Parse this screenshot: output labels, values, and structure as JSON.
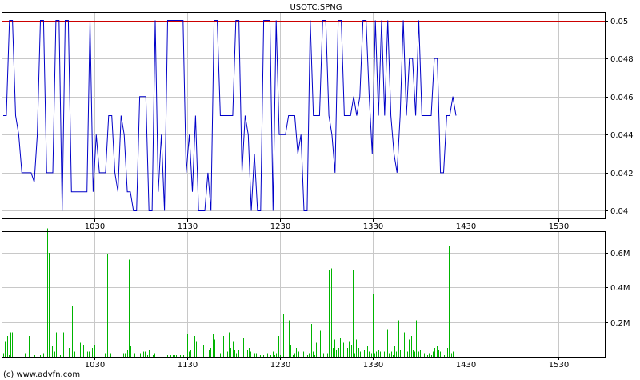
{
  "footer": {
    "credit": "(c) www.advfn.com"
  },
  "chart_data": [
    {
      "type": "line",
      "title": "USOTC:SPNG",
      "x_ticks": [
        "1030",
        "1130",
        "1230",
        "1330",
        "1430",
        "1530"
      ],
      "y_ticks": [
        "0.04",
        "0.042",
        "0.044",
        "0.046",
        "0.048",
        "0.05"
      ],
      "ylim": [
        0.0396,
        0.0504
      ],
      "grid": true,
      "series": [
        {
          "color": "#0000c8",
          "values": [
            0.045,
            0.045,
            0.05,
            0.05,
            0.045,
            0.044,
            0.042,
            0.042,
            0.042,
            0.042,
            0.0415,
            0.044,
            0.05,
            0.05,
            0.042,
            0.042,
            0.042,
            0.05,
            0.05,
            0.04,
            0.05,
            0.05,
            0.041,
            0.041,
            0.041,
            0.041,
            0.041,
            0.041,
            0.05,
            0.041,
            0.044,
            0.042,
            0.042,
            0.042,
            0.045,
            0.045,
            0.042,
            0.041,
            0.045,
            0.044,
            0.041,
            0.041,
            0.04,
            0.04,
            0.046,
            0.046,
            0.046,
            0.04,
            0.04,
            0.05,
            0.041,
            0.044,
            0.04,
            0.05,
            0.05,
            0.05,
            0.05,
            0.05,
            0.05,
            0.042,
            0.044,
            0.041,
            0.045,
            0.04,
            0.04,
            0.04,
            0.042,
            0.04,
            0.05,
            0.05,
            0.045,
            0.045,
            0.045,
            0.045,
            0.045,
            0.05,
            0.05,
            0.042,
            0.045,
            0.044,
            0.04,
            0.043,
            0.04,
            0.04,
            0.05,
            0.05,
            0.05,
            0.04,
            0.05,
            0.044,
            0.044,
            0.044,
            0.045,
            0.045,
            0.045,
            0.043,
            0.044,
            0.04,
            0.04,
            0.05,
            0.045,
            0.045,
            0.045,
            0.05,
            0.05,
            0.045,
            0.044,
            0.042,
            0.05,
            0.05,
            0.045,
            0.045,
            0.045,
            0.046,
            0.045,
            0.046,
            0.05,
            0.05,
            0.046,
            0.043,
            0.05,
            0.045,
            0.05,
            0.045,
            0.05,
            0.045,
            0.043,
            0.042,
            0.045,
            0.05,
            0.045,
            0.048,
            0.048,
            0.045,
            0.05,
            0.045,
            0.045,
            0.045,
            0.045,
            0.048,
            0.048,
            0.042,
            0.042,
            0.045,
            0.045,
            0.046,
            0.045
          ]
        }
      ],
      "reference_line": {
        "value": 0.05,
        "color": "#cc0000"
      }
    },
    {
      "type": "bar",
      "x_ticks": [
        "1030",
        "1130",
        "1230",
        "1330",
        "1430",
        "1530"
      ],
      "y_ticks": [
        "0.2M",
        "0.4M",
        "0.6M"
      ],
      "ylim": [
        0,
        0.72
      ],
      "grid": true,
      "bar_color": "#00b400",
      "values": [
        0.02,
        0.09,
        0.12,
        0.01,
        0.14,
        0.14,
        0,
        0,
        0,
        0,
        0.12,
        0,
        0.02,
        0,
        0.12,
        0,
        0,
        0.01,
        0,
        0,
        0.01,
        0,
        0.02,
        0,
        0.74,
        0.6,
        0,
        0.06,
        0.03,
        0.14,
        0,
        0.01,
        0,
        0.14,
        0,
        0,
        0.05,
        0,
        0.29,
        0.03,
        0,
        0.02,
        0.08,
        0.04,
        0.07,
        0,
        0.03,
        0.03,
        0,
        0.05,
        0.07,
        0,
        0.11,
        0,
        0.05,
        0,
        0.02,
        0.59,
        0,
        0.02,
        0,
        0,
        0,
        0.05,
        0,
        0,
        0.02,
        0.02,
        0.04,
        0.56,
        0.06,
        0,
        0.02,
        0,
        0.01,
        0.02,
        0,
        0.03,
        0.03,
        0.01,
        0.04,
        0,
        0.01,
        0.02,
        0,
        0.01,
        0,
        0,
        0,
        0,
        0.01,
        0,
        0.01,
        0.01,
        0.01,
        0.01,
        0,
        0.01,
        0.02,
        0.01,
        0.04,
        0.13,
        0.03,
        0.04,
        0,
        0.12,
        0.09,
        0.01,
        0,
        0.02,
        0.07,
        0.03,
        0,
        0.04,
        0.05,
        0.13,
        0.1,
        0,
        0.29,
        0.02,
        0.08,
        0.12,
        0.01,
        0.03,
        0.14,
        0.05,
        0.09,
        0.04,
        0.02,
        0.04,
        0,
        0.02,
        0.11,
        0,
        0.04,
        0.05,
        0.03,
        0,
        0.02,
        0.02,
        0,
        0.01,
        0.02,
        0.01,
        0,
        0.02,
        0,
        0.01,
        0.03,
        0.01,
        0.02,
        0.12,
        0.01,
        0.03,
        0.25,
        0.01,
        0,
        0.21,
        0.07,
        0.01,
        0.02,
        0.05,
        0.03,
        0,
        0.21,
        0.03,
        0.08,
        0.01,
        0.02,
        0.19,
        0.03,
        0.01,
        0.08,
        0,
        0.15,
        0.03,
        0.02,
        0.04,
        0.02,
        0.5,
        0.51,
        0.05,
        0.1,
        0.04,
        0.05,
        0.11,
        0.07,
        0.08,
        0.08,
        0.05,
        0.09,
        0.07,
        0.5,
        0.02,
        0.1,
        0.05,
        0.03,
        0.02,
        0.04,
        0.04,
        0.06,
        0.03,
        0.02,
        0.36,
        0.02,
        0.03,
        0.04,
        0.03,
        0.01,
        0.03,
        0.02,
        0.16,
        0.02,
        0.03,
        0.01,
        0.06,
        0.03,
        0.21,
        0.04,
        0.02,
        0.14,
        0.09,
        0.03,
        0.1,
        0.12,
        0.04,
        0.03,
        0.21,
        0.03,
        0.04,
        0.05,
        0.02,
        0.2,
        0.01,
        0.02,
        0.01,
        0.03,
        0.05,
        0.06,
        0.04,
        0.03,
        0.02,
        0.01,
        0.03,
        0.05,
        0.64,
        0.02,
        0.03
      ]
    }
  ]
}
